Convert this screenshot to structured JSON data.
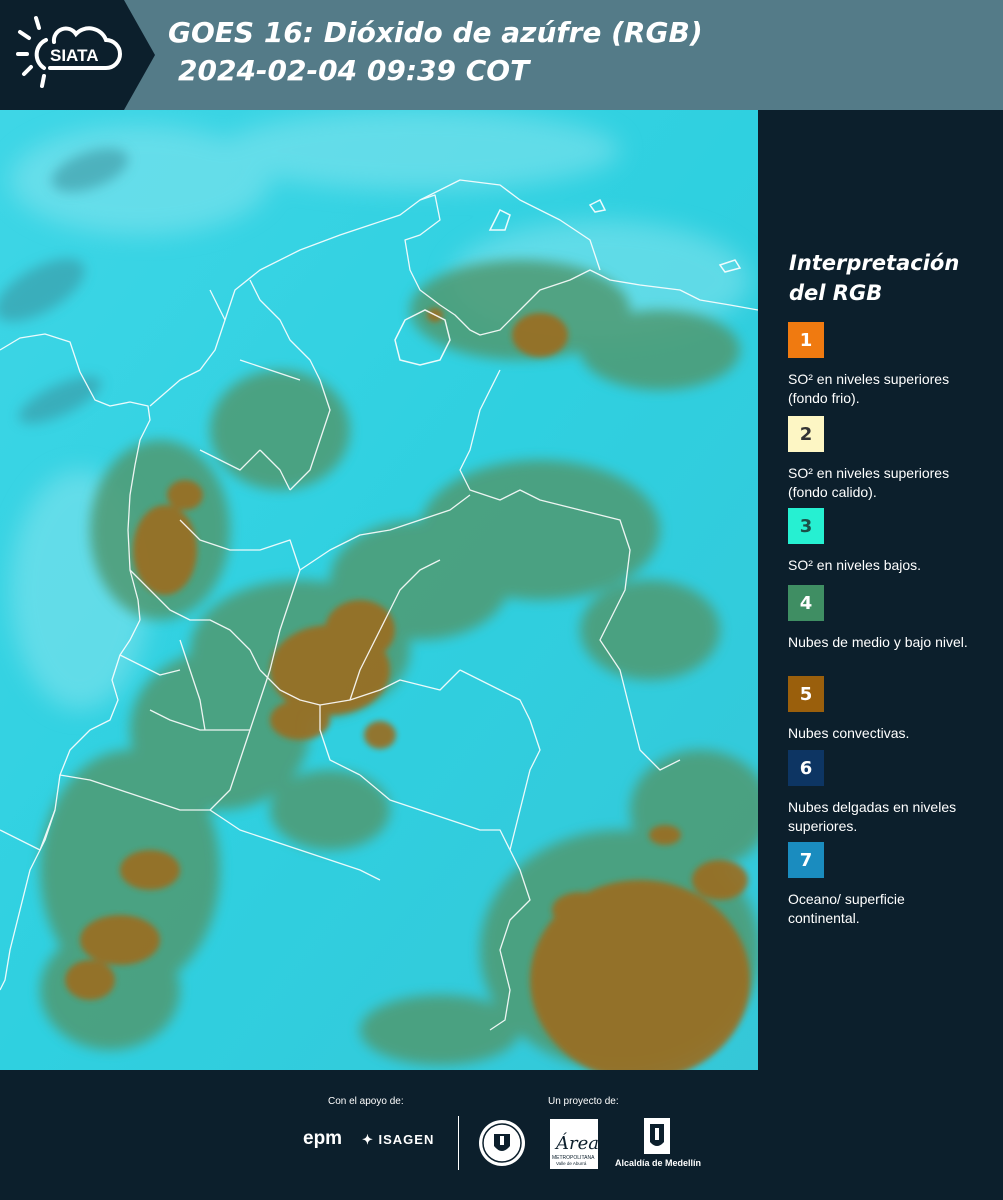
{
  "header": {
    "logo_text": "SIATA",
    "title_line1": "GOES 16: Dióxido de azúfre (RGB)",
    "title_line2": "2024-02-04 09:39 COT"
  },
  "legend": {
    "title": "Interpretación del RGB",
    "items": [
      {
        "number": "1",
        "color": "#f07a10",
        "text_color": "#ffffff",
        "label": "SO² en niveles superiores (fondo frio)."
      },
      {
        "number": "2",
        "color": "#fdf6c4",
        "text_color": "#333333",
        "label": "SO² en niveles superiores (fondo calido)."
      },
      {
        "number": "3",
        "color": "#26f0d2",
        "text_color": "#1b4f48",
        "label": "SO² en niveles bajos."
      },
      {
        "number": "4",
        "color": "#3f8e63",
        "text_color": "#ffffff",
        "label": "Nubes de medio y bajo nivel."
      },
      {
        "number": "5",
        "color": "#9a5f0c",
        "text_color": "#ffffff",
        "label": "Nubes convectivas."
      },
      {
        "number": "6",
        "color": "#0d3563",
        "text_color": "#ffffff",
        "label": "Nubes delgadas en niveles superiores."
      },
      {
        "number": "7",
        "color": "#1a8cbf",
        "text_color": "#ffffff",
        "label": "Oceano/ superficie continental."
      }
    ]
  },
  "map": {
    "background_color": "#2fd0e0",
    "cloud_colors": [
      "#9a6e22",
      "#4a9468",
      "#58a37e"
    ],
    "boundary_color": "#ffffff"
  },
  "footer": {
    "support_label": "Con el apoyo de:",
    "project_label": "Un proyecto de:",
    "epm": "epm",
    "isagen": "ISAGEN",
    "area_label": "Área",
    "area_sub": "METROPOLITANA",
    "area_sub2": "Valle de Aburrá",
    "alcaldia": "Alcaldía de Medellín"
  }
}
